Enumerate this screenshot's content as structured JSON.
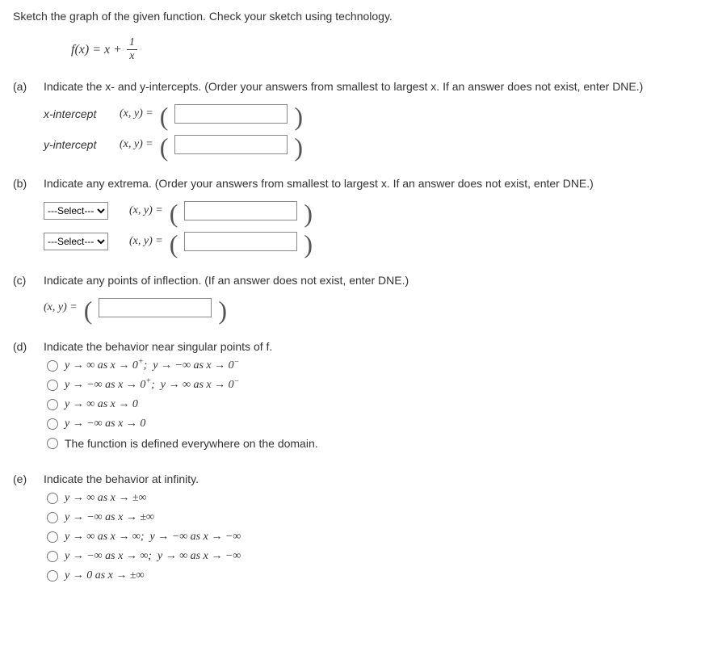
{
  "intro": "Sketch the graph of the given function. Check your sketch using technology.",
  "func_lhs": "f(x) = x +",
  "frac_num": "1",
  "frac_den": "x",
  "a": {
    "label": "(a)",
    "prompt": "Indicate the x- and y-intercepts. (Order your answers from smallest to largest x. If an answer does not exist, enter DNE.)",
    "rows": [
      {
        "label": "x-intercept",
        "xy": "(x, y)  ="
      },
      {
        "label": "y-intercept",
        "xy": "(x, y)  ="
      }
    ]
  },
  "b": {
    "label": "(b)",
    "prompt": "Indicate any extrema. (Order your answers from smallest to largest x. If an answer does not exist, enter DNE.)",
    "select_placeholder": "---Select---",
    "rows": [
      {
        "xy": "(x, y)  ="
      },
      {
        "xy": "(x, y)  ="
      }
    ]
  },
  "c": {
    "label": "(c)",
    "prompt": "Indicate any points of inflection. (If an answer does not exist, enter DNE.)",
    "xy": "(x, y) ="
  },
  "d": {
    "label": "(d)",
    "prompt": "Indicate the behavior near singular points of f.",
    "options": [
      "y → ∞ as x → 0⁺; y → −∞ as x → 0⁻",
      "y → −∞ as x → 0⁺; y → ∞ as x → 0⁻",
      "y → ∞ as x → 0",
      "y → −∞ as x → 0",
      "The function is defined everywhere on the domain."
    ]
  },
  "e": {
    "label": "(e)",
    "prompt": "Indicate the behavior at infinity.",
    "options": [
      "y → ∞ as x → ±∞",
      "y → −∞ as x → ±∞",
      "y → ∞ as x → ∞; y → −∞ as x → −∞",
      "y → −∞ as x → ∞; y → ∞ as x → −∞",
      "y → 0 as x → ±∞"
    ]
  }
}
